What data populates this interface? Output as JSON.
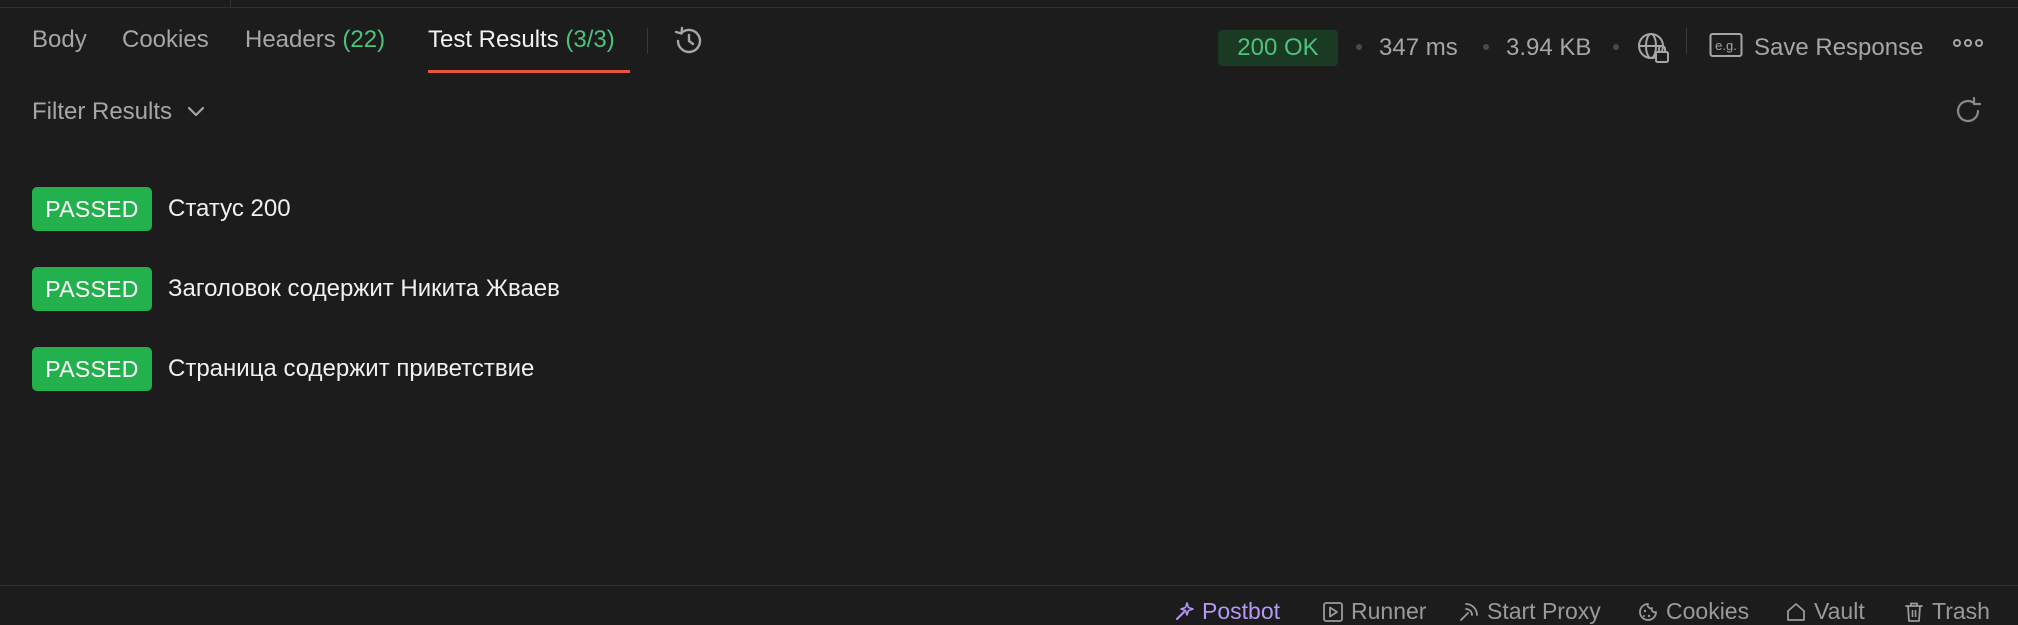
{
  "tabs": [
    {
      "label": "Body",
      "count": ""
    },
    {
      "label": "Cookies",
      "count": ""
    },
    {
      "label": "Headers",
      "count": "(22)"
    },
    {
      "label": "Test Results",
      "count": "(3/3)"
    }
  ],
  "response": {
    "status": "200 OK",
    "time": "347 ms",
    "size": "3.94 KB",
    "save_label": "Save Response"
  },
  "filter": {
    "label": "Filter Results"
  },
  "results": [
    {
      "status": "PASSED",
      "name": "Статус 200"
    },
    {
      "status": "PASSED",
      "name": "Заголовок содержит Никита Жваев"
    },
    {
      "status": "PASSED",
      "name": "Страница содержит приветствие"
    }
  ],
  "footer": {
    "postbot": "Postbot",
    "runner": "Runner",
    "start_proxy": "Start Proxy",
    "cookies": "Cookies",
    "vault": "Vault",
    "trash": "Trash"
  },
  "colors": {
    "background": "#1c1c1c",
    "accent_underline": "#e8553e",
    "pass_green": "#22b14c",
    "count_green": "#4cc37b",
    "postbot_purple": "#b597f6"
  },
  "icons": [
    "history-icon",
    "globe-lock-icon",
    "example-icon",
    "more-icon",
    "chevron-down-icon",
    "refresh-icon",
    "postbot-icon",
    "runner-icon",
    "proxy-icon",
    "cookie-icon",
    "vault-icon",
    "trash-icon"
  ]
}
